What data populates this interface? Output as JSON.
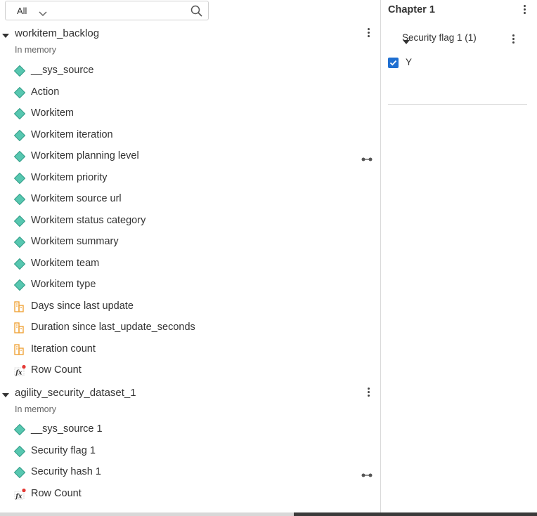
{
  "filter": {
    "value": "All"
  },
  "datasets": [
    {
      "name": "workitem_backlog",
      "subtitle": "In memory",
      "fields": [
        {
          "label": "__sys_source",
          "icon": "category-diamond-icon"
        },
        {
          "label": "Action",
          "icon": "category-diamond-icon"
        },
        {
          "label": "Workitem",
          "icon": "category-diamond-icon"
        },
        {
          "label": "Workitem iteration",
          "icon": "category-diamond-icon"
        },
        {
          "label": "Workitem planning level",
          "icon": "category-diamond-icon",
          "linked": true
        },
        {
          "label": "Workitem priority",
          "icon": "category-diamond-icon"
        },
        {
          "label": "Workitem source url",
          "icon": "category-diamond-icon"
        },
        {
          "label": "Workitem status category",
          "icon": "category-diamond-icon"
        },
        {
          "label": "Workitem summary",
          "icon": "category-diamond-icon"
        },
        {
          "label": "Workitem team",
          "icon": "category-diamond-icon"
        },
        {
          "label": "Workitem type",
          "icon": "category-diamond-icon"
        },
        {
          "label": "Days since last update",
          "icon": "measure-icon"
        },
        {
          "label": "Duration since last_update_seconds",
          "icon": "measure-icon"
        },
        {
          "label": "Iteration count",
          "icon": "measure-icon"
        },
        {
          "label": "Row Count",
          "icon": "calculated-fx-icon"
        }
      ]
    },
    {
      "name": "agility_security_dataset_1",
      "subtitle": "In memory",
      "fields": [
        {
          "label": "__sys_source 1",
          "icon": "category-diamond-icon"
        },
        {
          "label": "Security flag 1",
          "icon": "category-diamond-icon"
        },
        {
          "label": "Security hash 1",
          "icon": "category-diamond-icon",
          "linked": true
        },
        {
          "label": "Row Count",
          "icon": "calculated-fx-icon"
        }
      ]
    }
  ],
  "chapter": {
    "title": "Chapter 1",
    "filter_title": "Security flag 1 (1)",
    "options": [
      {
        "label": "Y",
        "checked": true
      }
    ]
  },
  "colors": {
    "category": "#57c7b0",
    "category_border": "#2f9c86",
    "measure": "#f0a43a",
    "checkbox": "#1f6fd1",
    "fx_dot": "#e53935"
  }
}
